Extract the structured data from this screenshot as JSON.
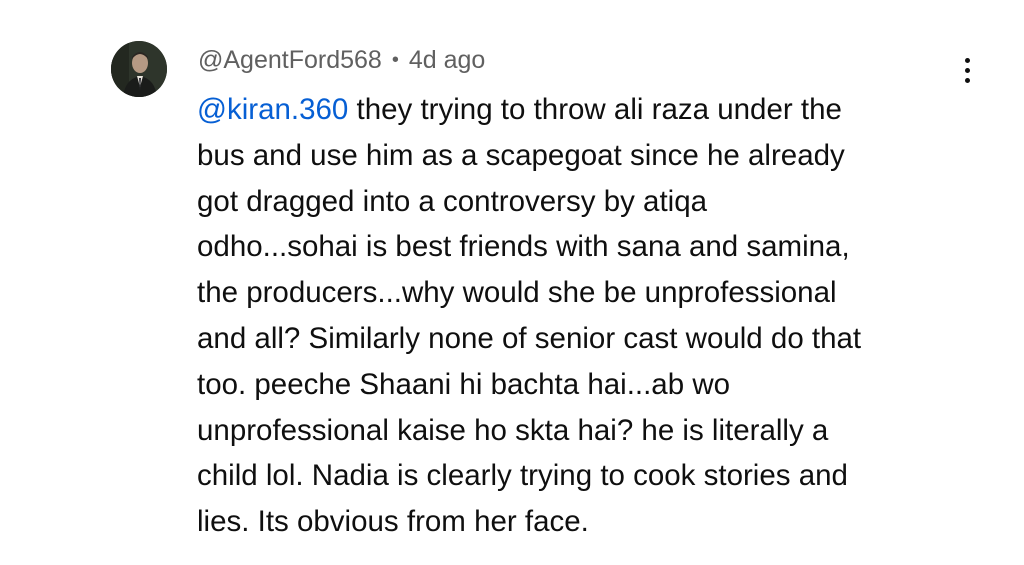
{
  "comment": {
    "author": "@AgentFord568",
    "separator": "•",
    "timestamp": "4d ago",
    "mention": "@kiran.360",
    "menu_icon": "more-vertical-icon",
    "mention_color": "#065fd4",
    "lines": [
      " they trying to throw ali raza under the",
      "bus and use him as a scapegoat since he already",
      "got dragged into a controversy by atiqa",
      "odho...sohai is best friends with sana and samina,",
      "the producers...why would she be unprofessional",
      "and all? Similarly none of senior cast would do that",
      "too. peeche Shaani hi bachta hai...ab wo",
      "unprofessional kaise ho skta hai? he is literally a",
      "child lol. Nadia is clearly trying to cook stories and",
      "lies. Its obvious from her face."
    ]
  }
}
